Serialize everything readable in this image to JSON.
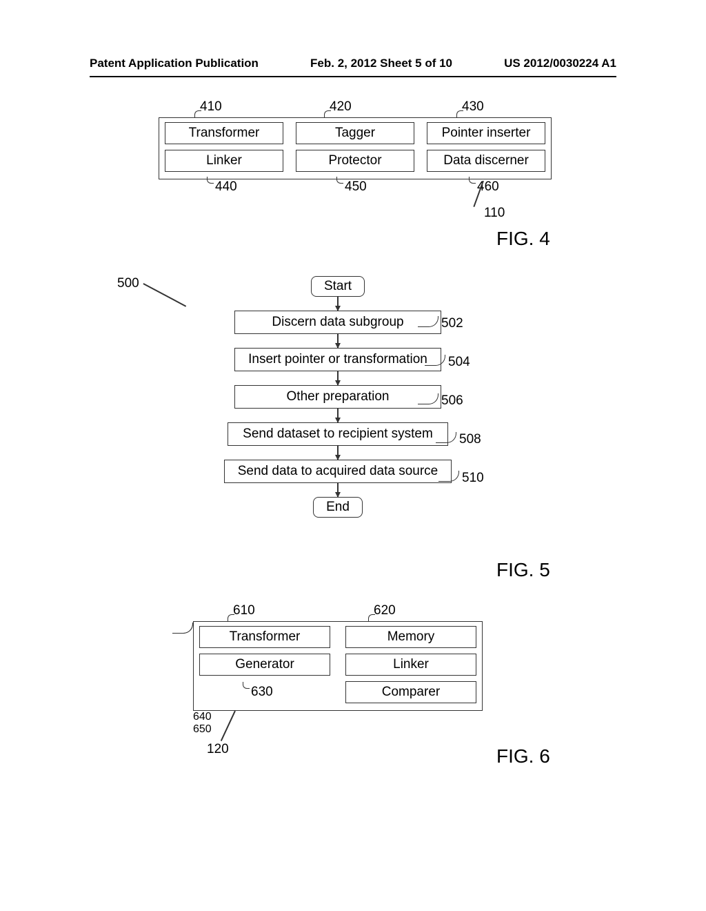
{
  "header": {
    "left": "Patent Application Publication",
    "mid": "Feb. 2, 2012  Sheet 5 of 10",
    "right": "US 2012/0030224 A1"
  },
  "fig4": {
    "label": "FIG. 4",
    "container_ref": "110",
    "top": {
      "b1": {
        "text": "Transformer",
        "ref": "410"
      },
      "b2": {
        "text": "Tagger",
        "ref": "420"
      },
      "b3": {
        "text": "Pointer inserter",
        "ref": "430"
      }
    },
    "bot": {
      "b1": {
        "text": "Linker",
        "ref": "440"
      },
      "b2": {
        "text": "Protector",
        "ref": "450"
      },
      "b3": {
        "text": "Data discerner",
        "ref": "460"
      }
    }
  },
  "fig5": {
    "label": "FIG. 5",
    "container_ref": "500",
    "start": "Start",
    "end": "End",
    "steps": [
      {
        "text": "Discern data subgroup",
        "ref": "502"
      },
      {
        "text": "Insert pointer or transformation",
        "ref": "504"
      },
      {
        "text": "Other preparation",
        "ref": "506"
      },
      {
        "text": "Send dataset to recipient system",
        "ref": "508"
      },
      {
        "text": "Send data to acquired data source",
        "ref": "510"
      }
    ]
  },
  "fig6": {
    "label": "FIG. 6",
    "container_ref": "120",
    "top": {
      "b1": {
        "text": "Transformer",
        "ref": "610"
      },
      "b2": {
        "text": "Memory",
        "ref": "620"
      }
    },
    "bot": {
      "b1": {
        "text": "Generator",
        "ref": "630"
      },
      "b2": {
        "text": "Linker",
        "ref": "640"
      }
    },
    "extra": {
      "text": "Comparer",
      "ref": "650"
    }
  }
}
